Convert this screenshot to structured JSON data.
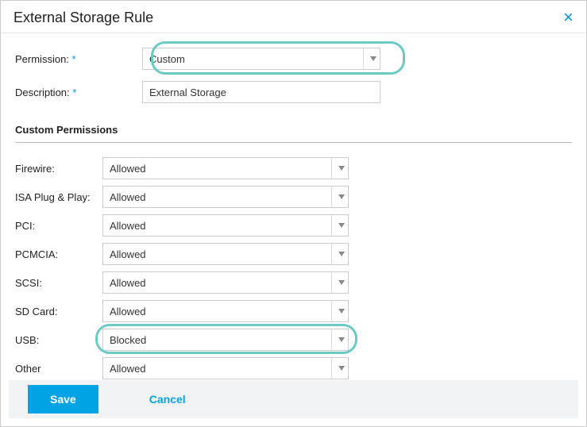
{
  "dialog": {
    "title": "External Storage Rule"
  },
  "form": {
    "permission_label": "Permission:",
    "permission_value": "Custom",
    "description_label": "Description:",
    "description_value": "External Storage"
  },
  "custom_permissions": {
    "title": "Custom Permissions",
    "rows": [
      {
        "label": "Firewire:",
        "value": "Allowed"
      },
      {
        "label": "ISA Plug & Play:",
        "value": "Allowed"
      },
      {
        "label": "PCI:",
        "value": "Allowed"
      },
      {
        "label": "PCMCIA:",
        "value": "Allowed"
      },
      {
        "label": "SCSI:",
        "value": "Allowed"
      },
      {
        "label": "SD Card:",
        "value": "Allowed"
      },
      {
        "label": "USB:",
        "value": "Blocked"
      },
      {
        "label": "Other",
        "value": "Allowed"
      }
    ]
  },
  "footer": {
    "save": "Save",
    "cancel": "Cancel"
  }
}
